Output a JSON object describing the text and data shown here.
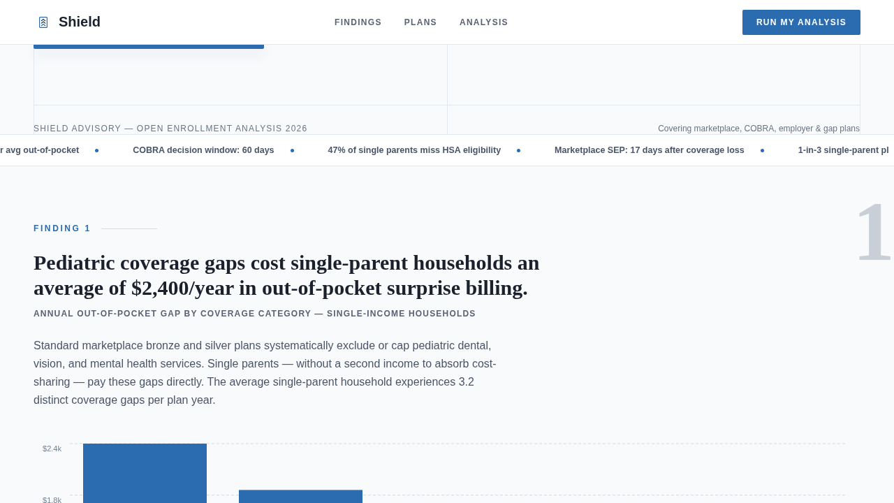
{
  "header": {
    "logo": "Shield",
    "nav": [
      {
        "label": "FINDINGS"
      },
      {
        "label": "PLANS"
      },
      {
        "label": "ANALYSIS"
      }
    ],
    "cta": "RUN MY ANALYSIS"
  },
  "hero": {
    "caption_left": "SHIELD ADVISORY — OPEN ENROLLMENT ANALYSIS 2026",
    "caption_right": "Covering marketplace, COBRA, employer & gap plans"
  },
  "ticker": [
    "r avg out-of-pocket",
    "COBRA decision window: 60 days",
    "47% of single parents miss HSA eligibility",
    "Marketplace SEP: 17 days after coverage loss",
    "1-in-3 single-parent pl"
  ],
  "finding": {
    "label": "FINDING 1",
    "number": "1",
    "title": "Pediatric coverage gaps cost single-parent households an average of $2,400/year in out-of-pocket surprise billing.",
    "subtitle": "ANNUAL OUT-OF-POCKET GAP BY COVERAGE CATEGORY — SINGLE-INCOME HOUSEHOLDS",
    "body": "Standard marketplace bronze and silver plans systematically exclude or cap pediatric dental, vision, and mental health services. Single parents — without a second income to absorb cost-sharing — pay these gaps directly. The average single-parent household experiences 3.2 distinct coverage gaps per plan year.",
    "chart_data": [
      {
        "type": "bar",
        "categories": [
          null,
          null
        ],
        "values": [
          2400,
          1860
        ],
        "color": "#2b6cb0",
        "ylim": [
          1700,
          2400
        ],
        "yticks": [
          {
            "value": 1800,
            "label": "$1.8k"
          },
          {
            "value": 2400,
            "label": "$2.4k"
          }
        ],
        "grid": true
      }
    ]
  }
}
